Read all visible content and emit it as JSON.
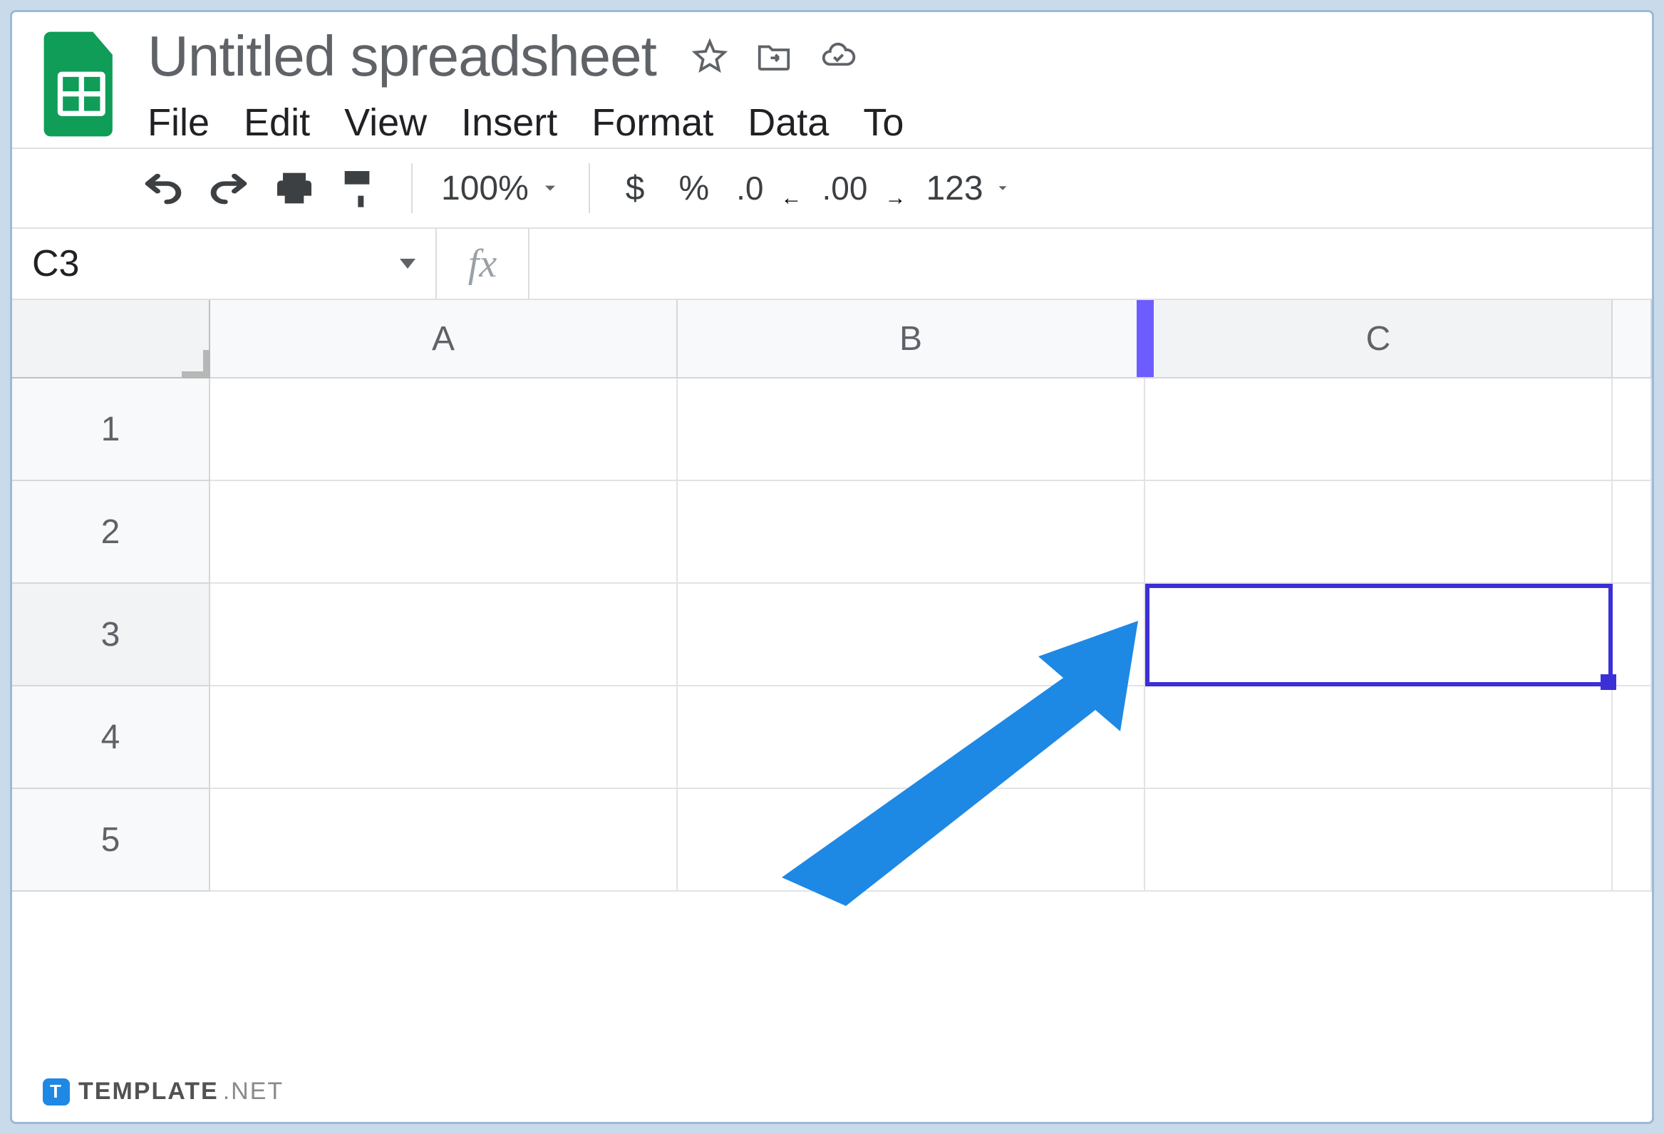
{
  "header": {
    "title": "Untitled spreadsheet"
  },
  "menus": [
    "File",
    "Edit",
    "View",
    "Insert",
    "Format",
    "Data",
    "To"
  ],
  "toolbar": {
    "zoom": "100%",
    "currency": "$",
    "percent": "%",
    "dec_less": ".0",
    "dec_more": ".00",
    "format_123": "123"
  },
  "namebox": {
    "value": "C3"
  },
  "fx": {
    "label": "fx",
    "value": ""
  },
  "columns": [
    "A",
    "B",
    "C"
  ],
  "rows": [
    "1",
    "2",
    "3",
    "4",
    "5"
  ],
  "selection": {
    "cell": "C3"
  },
  "watermark": {
    "brand": "TEMPLATE",
    "suffix": ".NET",
    "badge": "T"
  }
}
